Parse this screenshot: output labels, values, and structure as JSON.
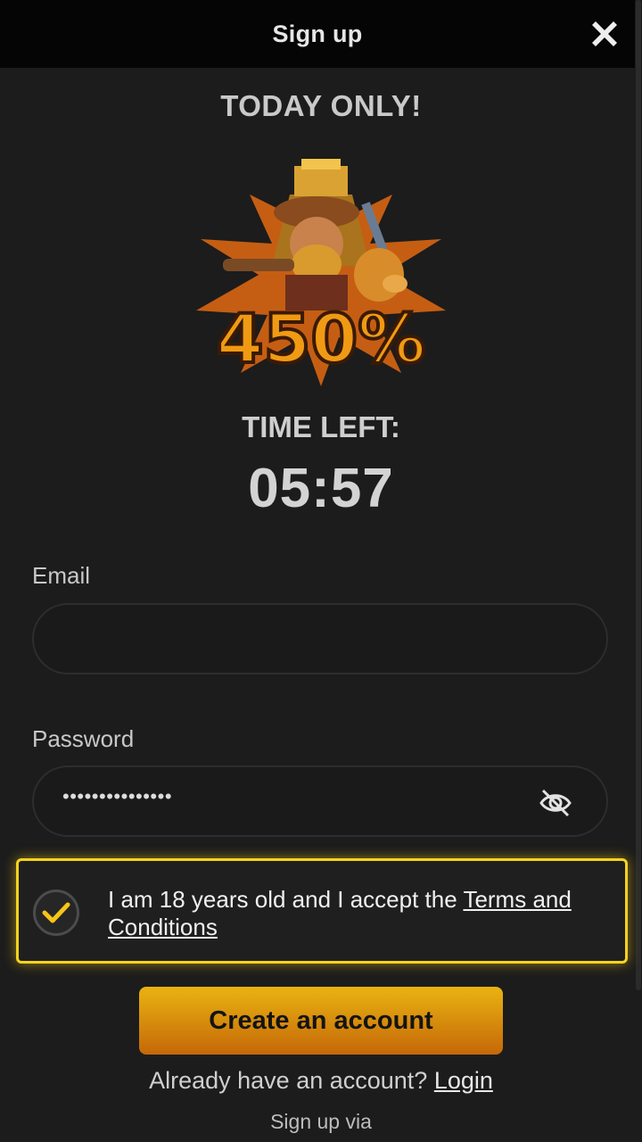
{
  "header": {
    "title": "Sign up",
    "close_icon": "close-x-icon"
  },
  "promo": {
    "headline": "TODAY ONLY!",
    "bonus_text": "450%",
    "time_left_label": "TIME LEFT:",
    "timer": "05:57"
  },
  "form": {
    "email_label": "Email",
    "email_value": "",
    "password_label": "Password",
    "password_masked": "•••••••••••••••",
    "password_toggle_icon": "eye-slash-icon"
  },
  "consent": {
    "checked": true,
    "text": "I am 18 years old and I accept the ",
    "link": "Terms and Conditions"
  },
  "actions": {
    "create_account": "Create an account",
    "already_have": "Already have an account? ",
    "login_link": "Login",
    "signup_via": "Sign up via"
  },
  "colors": {
    "background": "#1c1c1c",
    "accent_yellow": "#f5d31b",
    "button_gradient_top": "#e9b312",
    "button_gradient_bottom": "#c56808"
  }
}
